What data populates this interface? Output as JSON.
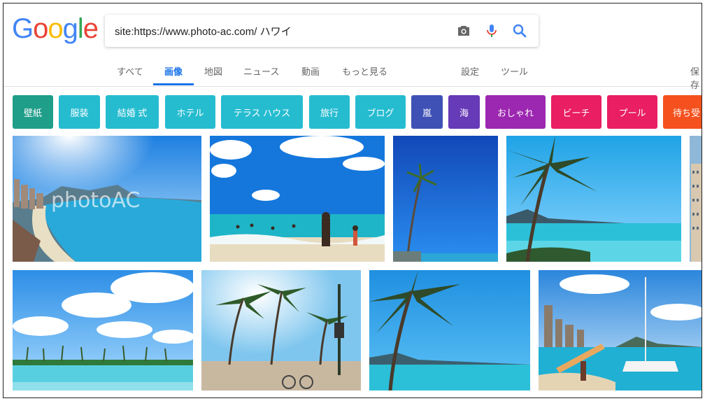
{
  "logo": {
    "letters": [
      "G",
      "o",
      "o",
      "g",
      "l",
      "e"
    ],
    "colors": [
      "#4285F4",
      "#EA4335",
      "#FBBC05",
      "#4285F4",
      "#34A853",
      "#EA4335"
    ]
  },
  "search": {
    "query": "site:https://www.photo-ac.com/ ハワイ"
  },
  "icons": {
    "camera": "camera-icon",
    "mic": "microphone-icon",
    "search": "search-icon"
  },
  "tabs": [
    {
      "label": "すべて"
    },
    {
      "label": "画像"
    },
    {
      "label": "地図"
    },
    {
      "label": "ニュース"
    },
    {
      "label": "動画"
    },
    {
      "label": "もっと見る"
    }
  ],
  "settings": {
    "settings_label": "設定",
    "tools_label": "ツール",
    "safe_label": "保存"
  },
  "chips": [
    {
      "label": "壁紙",
      "color": "#1f9e89"
    },
    {
      "label": "服装",
      "color": "#26bcd0"
    },
    {
      "label": "結婚 式",
      "color": "#26bcd0"
    },
    {
      "label": "ホテル",
      "color": "#26bcd0"
    },
    {
      "label": "テラス ハウス",
      "color": "#26bcd0"
    },
    {
      "label": "旅行",
      "color": "#26bcd0"
    },
    {
      "label": "ブログ",
      "color": "#26bcd0"
    },
    {
      "label": "嵐",
      "color": "#3f51b5"
    },
    {
      "label": "海",
      "color": "#673ab7"
    },
    {
      "label": "おしゃれ",
      "color": "#9c27b0"
    },
    {
      "label": "ビーチ",
      "color": "#e91e63"
    },
    {
      "label": "プール",
      "color": "#e91e63"
    },
    {
      "label": "待ち受",
      "color": "#f4511e"
    }
  ],
  "watermark": "photoAC",
  "colors": {
    "accent": "#1a73e8"
  }
}
